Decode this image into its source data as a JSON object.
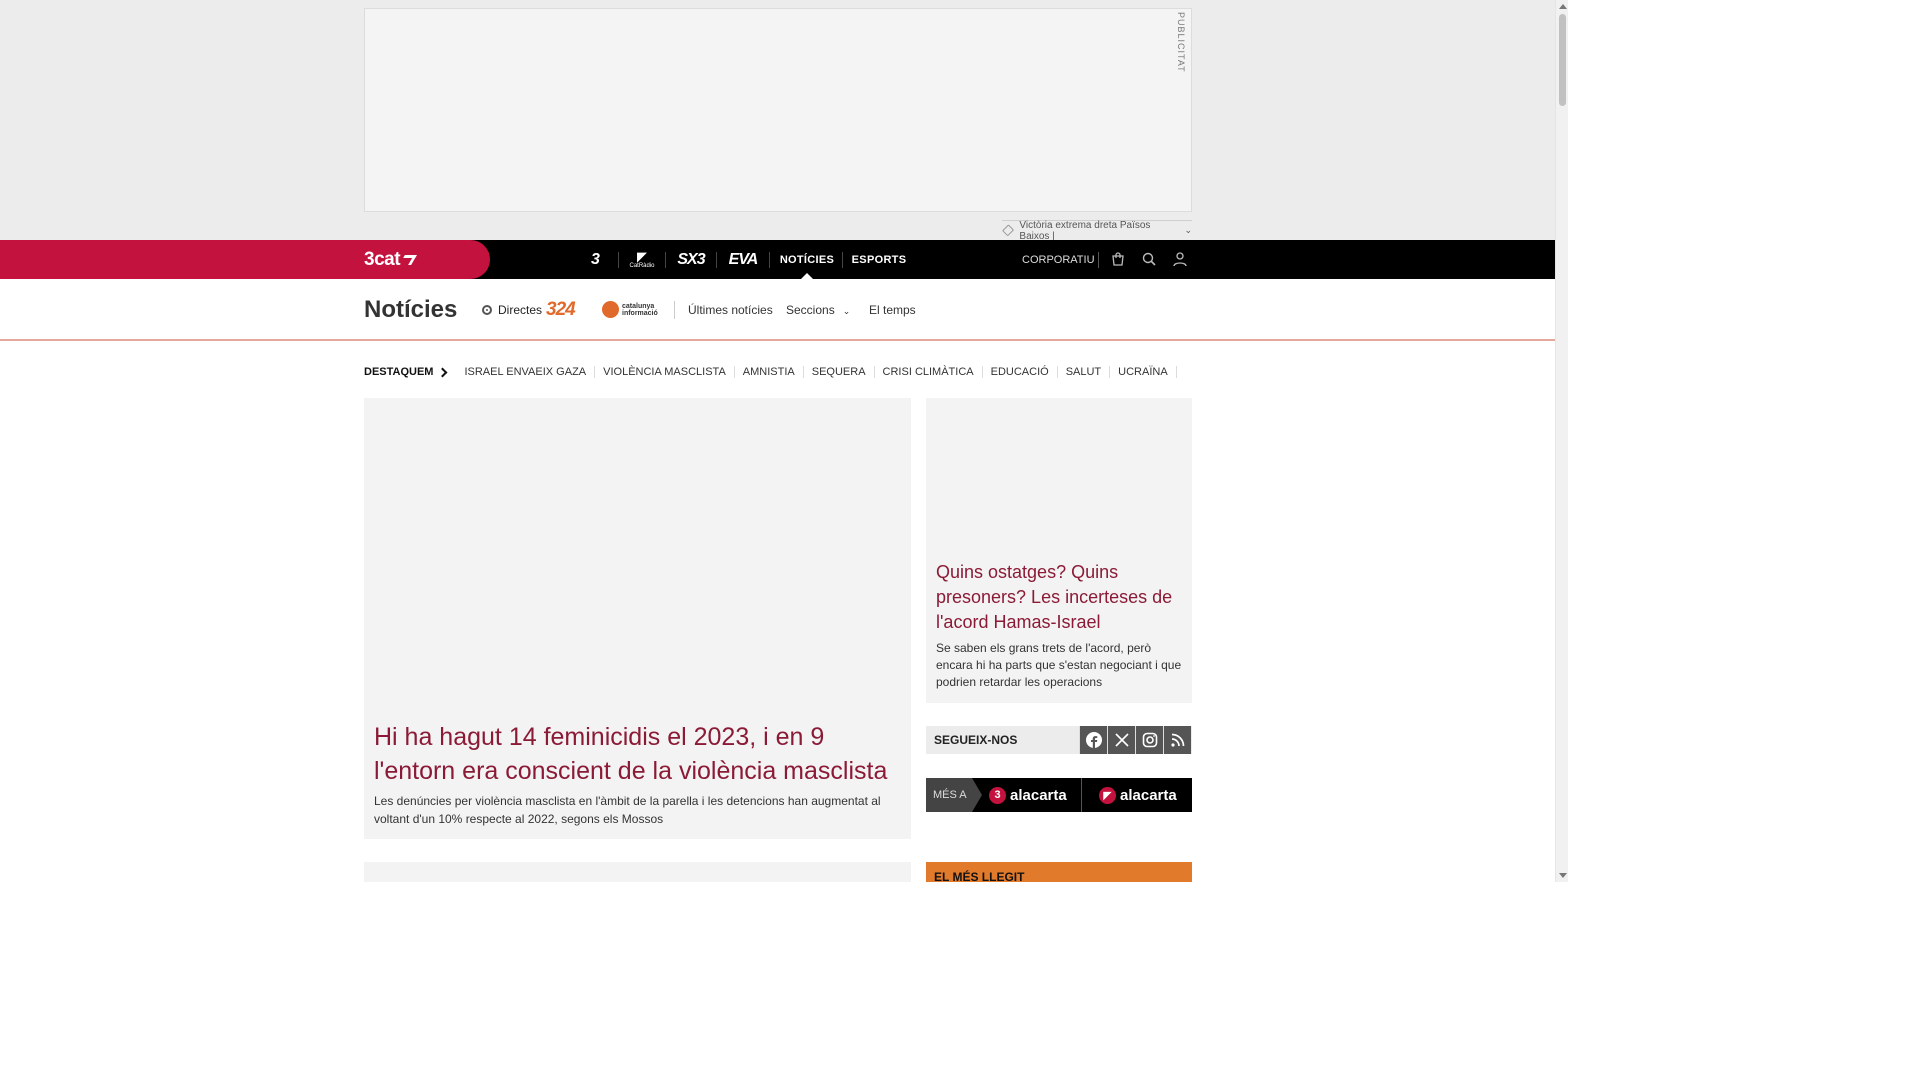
{
  "ad": {
    "label": "PUBLICITAT"
  },
  "trending": {
    "text": "Victòria extrema dreta Països Baixos |"
  },
  "topnav": {
    "brand": "3cat",
    "channels": [
      {
        "name": "tv3",
        "label": "3"
      },
      {
        "name": "catradio",
        "label": "CatRàdio"
      },
      {
        "name": "sx3",
        "label": "SX3"
      },
      {
        "name": "eva",
        "label": "EVA"
      }
    ],
    "noticies": "NOTÍCIES",
    "esports": "ESPORTS",
    "corporatiu": "CORPORATIU"
  },
  "subnav": {
    "title": "Notícies",
    "live": "Directes",
    "logo_324": "324",
    "catinfo_line1": "catalunya",
    "catinfo_line2": "informació",
    "links": [
      "Últimes notícies",
      "Seccions",
      "El temps"
    ]
  },
  "destaquem": {
    "label": "DESTAQUEM",
    "topics": [
      "ISRAEL ENVAEIX GAZA",
      "VIOLÈNCIA MASCLISTA",
      "AMNISTIA",
      "SEQUERA",
      "CRISI CLIMÀTICA",
      "EDUCACIÓ",
      "SALUT",
      "UCRAÏNA"
    ]
  },
  "lead": {
    "title": "Hi ha hagut 14 feminicidis el 2023, i en 9 l'entorn era conscient de la violència masclista",
    "summary": "Les denúncies per violència masclista en l'àmbit de la parella i les detencions han augmentat al voltant d'un 10% respecte al 2022, segons els Mossos"
  },
  "side": {
    "title": "Quins ostatges? Quins presoners? Les incerteses de l'acord Hamas-Israel",
    "summary": "Se saben els grans trets de l'acord, però encara hi ha parts que s'estan negociant i que podrien retardar les operacions"
  },
  "follow": {
    "label": "SEGUEIX-NOS",
    "networks": [
      "facebook",
      "x",
      "instagram",
      "rss"
    ]
  },
  "mesa": {
    "label": "MÉS A",
    "brand1": "alacarta",
    "brand2": "alacarta"
  },
  "mesllegit": {
    "label": "EL MÉS LLEGIT"
  },
  "colors": {
    "brand_red": "#c4123f",
    "headline": "#8b1a36",
    "accent_orange": "#e27a2b"
  }
}
